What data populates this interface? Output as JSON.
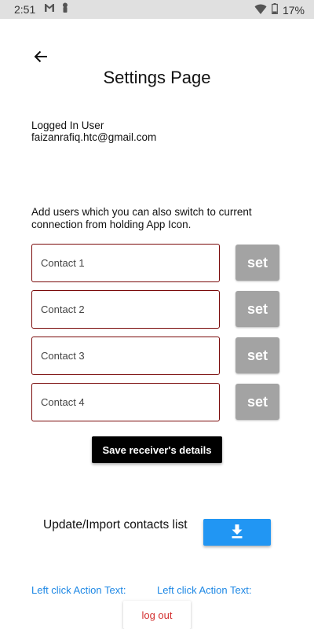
{
  "status_bar": {
    "time": "2:51",
    "battery_percent": "17%",
    "icons": [
      "gmail-icon",
      "notification-icon",
      "wifi-icon",
      "battery-icon"
    ]
  },
  "header": {
    "title": "Settings Page",
    "back_icon": "arrow-left-icon"
  },
  "user": {
    "label": "Logged In User",
    "email": "faizanrafiq.htc@gmail.com"
  },
  "instructions": "Add users which you can also switch to current connection from holding App Icon.",
  "contacts": [
    {
      "placeholder": "Contact 1",
      "button_label": "set"
    },
    {
      "placeholder": "Contact 2",
      "button_label": "set"
    },
    {
      "placeholder": "Contact 3",
      "button_label": "set"
    },
    {
      "placeholder": "Contact 4",
      "button_label": "set"
    }
  ],
  "save_button": "Save receiver's details",
  "import": {
    "label": "Update/Import contacts list",
    "icon": "download-icon"
  },
  "actions": {
    "left_text_1": "Left click Action Text:",
    "left_text_2": "Left click Action Text:"
  },
  "logout_button": "log out",
  "colors": {
    "status_bar_bg": "#e0e0e0",
    "input_border": "#7a0a0a",
    "set_button_bg": "#a3a3a3",
    "save_button_bg": "#000000",
    "import_button_bg": "#2196f3",
    "action_text": "#1e88e5",
    "logout_text": "#d32f2f"
  }
}
